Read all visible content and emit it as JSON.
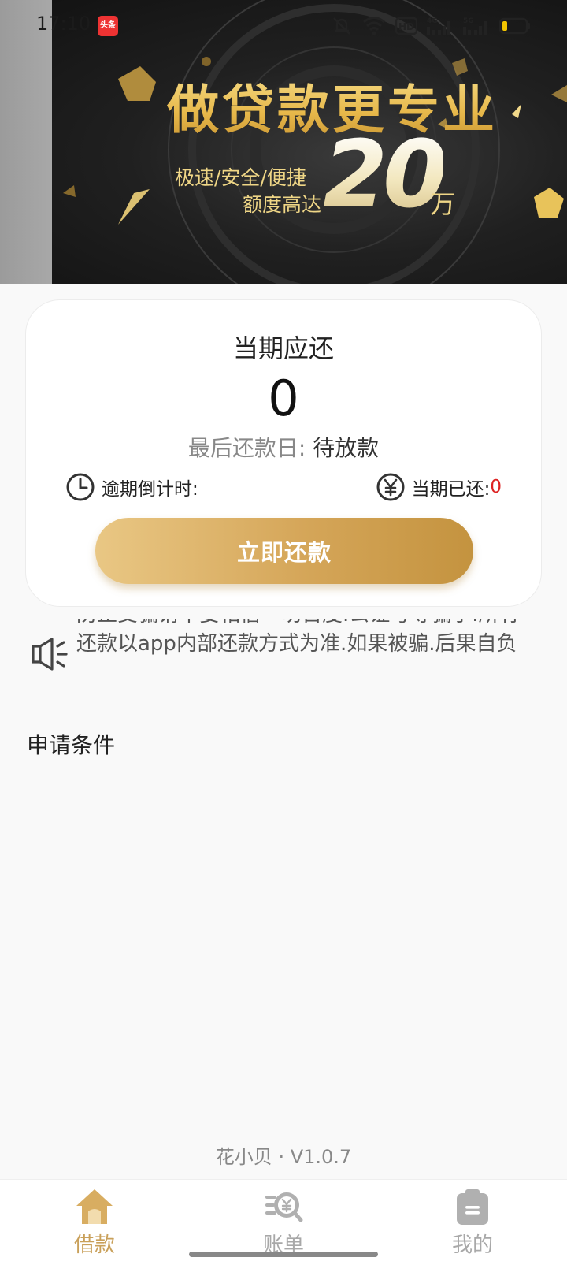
{
  "status_bar": {
    "time": "17:10",
    "app_badge": "头条",
    "icons": [
      "bell-muted-icon",
      "wifi-icon",
      "hd-icon",
      "signal-4g-icon",
      "signal-5g-icon",
      "battery-icon"
    ],
    "hd_label": "HD",
    "net1_label": "4G",
    "net2_label": "5G"
  },
  "banner": {
    "title": "做贷款更专业",
    "subtitle_line1": "极速/安全/便捷",
    "subtitle_line2": "额度高达",
    "amount": "20",
    "unit": "万",
    "colors": {
      "background": "#1c1c1c",
      "gold": "#e9c45a"
    }
  },
  "repayment_card": {
    "title": "当期应还",
    "amount": "0",
    "due_date_label": "最后还款日:",
    "due_date_value": "待放款",
    "countdown_label": "逾期倒计时:",
    "paid_label": "当期已还:",
    "paid_value": "0",
    "repay_button_label": "立即还款"
  },
  "notice": {
    "icon": "speaker-icon",
    "text": "防止受骗请不要相信一切百度.公证号等骗子.所有还款以app内部还款方式为准.如果被骗.后果自负"
  },
  "conditions": {
    "title": "申请条件"
  },
  "footer": {
    "version": "花小贝 · V1.0.7"
  },
  "bottom_nav": {
    "items": [
      {
        "label": "借款",
        "icon": "home-icon",
        "active": true
      },
      {
        "label": "账单",
        "icon": "bill-search-icon",
        "active": false
      },
      {
        "label": "我的",
        "icon": "profile-clipboard-icon",
        "active": false
      }
    ],
    "active_color": "#c9a05a",
    "inactive_color": "#a8a8a8"
  }
}
